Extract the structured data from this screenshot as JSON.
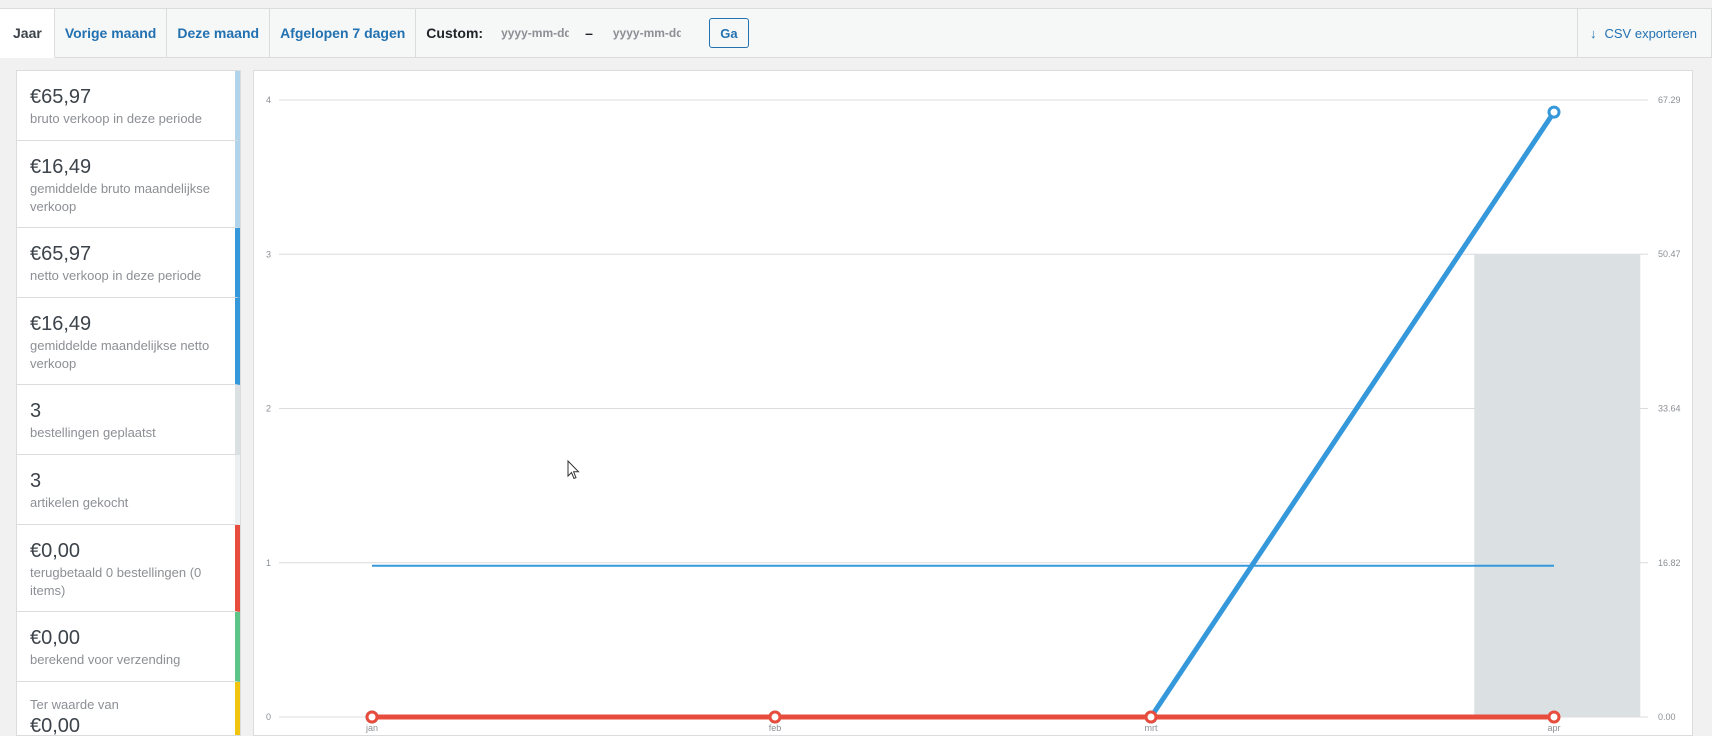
{
  "tabs": [
    {
      "label": "Jaar",
      "active": true
    },
    {
      "label": "Vorige maand"
    },
    {
      "label": "Deze maand"
    },
    {
      "label": "Afgelopen 7 dagen"
    }
  ],
  "custom": {
    "label": "Custom:",
    "start_placeholder": "yyyy-mm-dd",
    "separator": "–",
    "end_placeholder": "yyyy-mm-dd",
    "go_label": "Ga"
  },
  "export": {
    "label": "CSV exporteren",
    "icon": "download-arrow-icon"
  },
  "legend": [
    {
      "amount": "€65,97",
      "desc": "bruto verkoop in deze periode",
      "color": "#b1d4ea"
    },
    {
      "amount": "€16,49",
      "desc": "gemiddelde bruto maandelijkse verkoop",
      "color": "#b1d4ea"
    },
    {
      "amount": "€65,97",
      "desc": "netto verkoop in deze periode",
      "color": "#3498db"
    },
    {
      "amount": "€16,49",
      "desc": "gemiddelde maandelijkse netto verkoop",
      "color": "#3498db"
    },
    {
      "amount": "3",
      "desc": "bestellingen geplaatst",
      "color": "#dbe1e3"
    },
    {
      "amount": "3",
      "desc": "artikelen gekocht",
      "color": "#ecf0f1"
    },
    {
      "amount": "€0,00",
      "desc": "terugbetaald 0 bestellingen (0 items)",
      "color": "#e74c3c"
    },
    {
      "amount": "€0,00",
      "desc": "berekend voor verzending",
      "color": "#5cc488"
    },
    {
      "pre": "Ter waarde van",
      "amount": "€0,00",
      "desc": "",
      "color": "#f1c40f"
    }
  ],
  "chart_data": {
    "type": "line",
    "categories": [
      "jan",
      "feb",
      "mrt",
      "apr"
    ],
    "left_axis": {
      "ticks": [
        "0",
        "1",
        "2",
        "3",
        "4"
      ],
      "range": [
        0,
        4
      ]
    },
    "right_axis": {
      "ticks": [
        "0.00",
        "16.82",
        "33.64",
        "50.47",
        "67.29"
      ],
      "range": [
        0,
        67.29
      ]
    },
    "series": [
      {
        "kind": "bar",
        "axis": "left",
        "color": "#dbe1e3",
        "values": [
          0,
          0,
          0,
          3
        ]
      },
      {
        "kind": "line",
        "axis": "right",
        "color": "#3498db",
        "values": [
          0,
          0,
          0,
          65.97
        ],
        "markers": true
      },
      {
        "kind": "line",
        "axis": "right",
        "color": "#3498db",
        "values": [
          16.49,
          16.49,
          16.49,
          16.49
        ],
        "markers": false,
        "thin": true
      },
      {
        "kind": "line",
        "axis": "right",
        "color": "#e74c3c",
        "values": [
          0,
          0,
          0,
          0
        ],
        "markers": true
      }
    ],
    "grid": true
  }
}
